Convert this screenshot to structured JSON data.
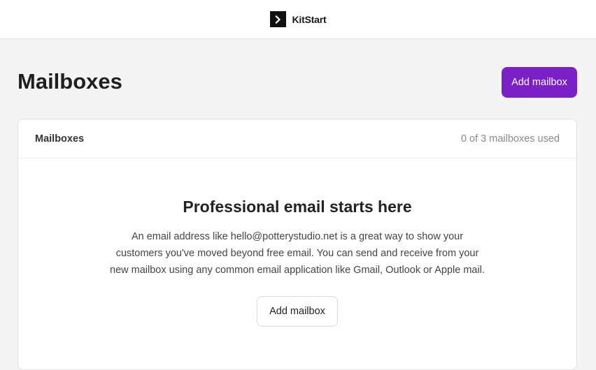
{
  "brand": {
    "name": "KitStart",
    "logo_icon": "chevron-right-icon"
  },
  "page": {
    "title": "Mailboxes",
    "add_button_label": "Add mailbox"
  },
  "card": {
    "header_title": "Mailboxes",
    "usage_text": "0 of 3 mailboxes used",
    "empty_title": "Professional email starts here",
    "empty_description": "An email address like hello@potterystudio.net is a great way to show your customers you've moved beyond free email. You can send and receive from your new mailbox using any common email application like Gmail, Outlook or Apple mail.",
    "add_button_label": "Add mailbox"
  },
  "colors": {
    "accent": "#7b20c8",
    "background": "#f4f4f4",
    "logo": "#111111"
  }
}
